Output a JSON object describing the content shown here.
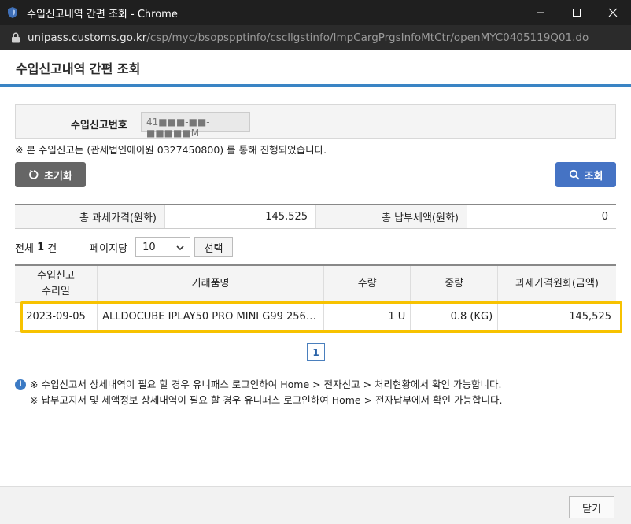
{
  "window": {
    "title": "수입신고내역 간편 조회 - Chrome"
  },
  "address": {
    "domain": "unipass.customs.go.kr",
    "path": "/csp/myc/bsopspptinfo/cscllgstinfo/ImpCargPrgsInfoMtCtr/openMYC0405119Q01.do"
  },
  "page": {
    "title": "수입신고내역 간편 조회"
  },
  "search": {
    "label": "수입신고번호",
    "value": "41■■■-■■-■■■■■M",
    "notice": "※ 본 수입신고는 (관세법인에이원 0327450800) 를 통해 진행되었습니다."
  },
  "buttons": {
    "reset": "초기화",
    "search": "조회",
    "select": "선택",
    "close": "닫기"
  },
  "summary": {
    "taxable_label": "총 과세가격(원화)",
    "taxable_value": "145,525",
    "tax_label": "총 납부세액(원화)",
    "tax_value": "0"
  },
  "listing": {
    "total_prefix": "전체",
    "total_count": "1",
    "total_suffix": "건",
    "perpage_label": "페이지당",
    "perpage_value": "10"
  },
  "table": {
    "headers": [
      "수입신고\n수리일",
      "거래품명",
      "수량",
      "중량",
      "과세가격원화(금액)"
    ],
    "rows": [
      {
        "date": "2023-09-05",
        "item": "ALLDOCUBE IPLAY50 PRO MINI G99 256G...",
        "qty": "1 U",
        "weight": "0.8 (KG)",
        "amount": "145,525"
      }
    ]
  },
  "pagination": {
    "current": "1"
  },
  "info": {
    "line1": "※ 수입신고서 상세내역이 필요 할 경우 유니패스 로그인하여 Home > 전자신고 > 처리현황에서 확인 가능합니다.",
    "line2": "※ 납부고지서 및 세액정보 상세내역이 필요 할 경우 유니패스 로그인하여 Home > 전자납부에서 확인 가능합니다."
  },
  "colors": {
    "accent": "#3a84c4",
    "search_button": "#4573c4",
    "reset_button": "#666666",
    "highlight": "#f7c200"
  },
  "icons": {
    "app": "shield-icon",
    "lock": "lock-icon",
    "reset": "refresh-icon",
    "search": "search-icon",
    "info": "info-icon"
  }
}
